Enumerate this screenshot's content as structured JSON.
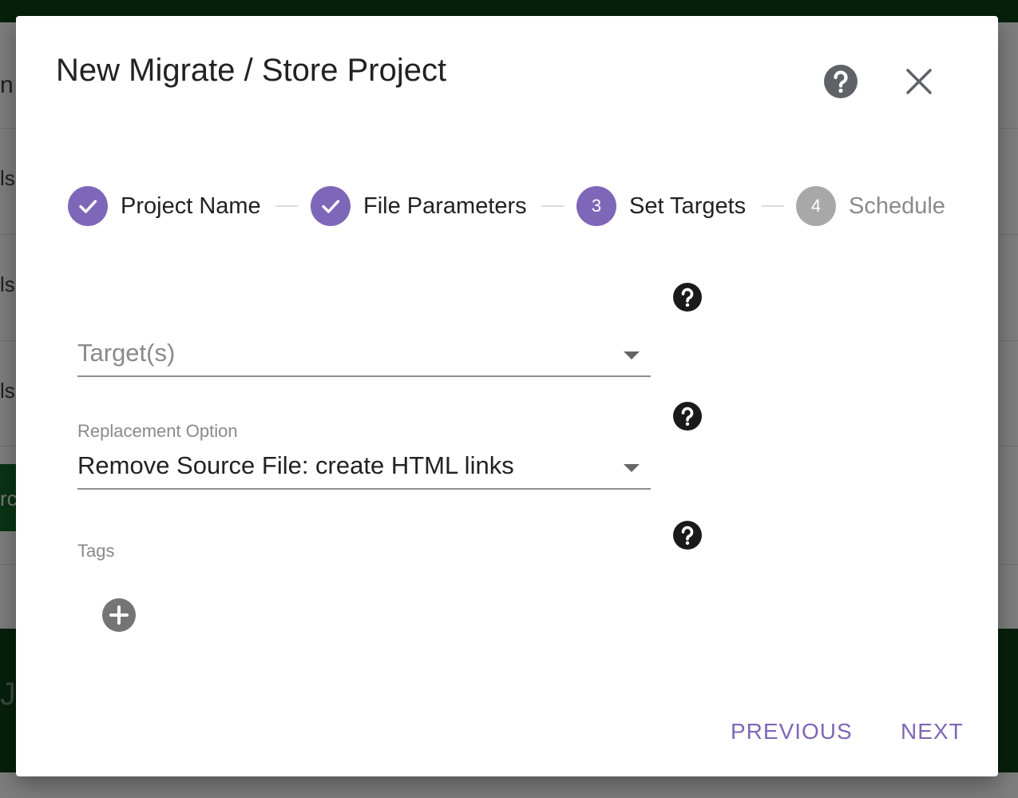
{
  "background": {
    "row_letters": [
      "n",
      "ls",
      "ls",
      "ls"
    ],
    "green_button_fragment": "rc",
    "band_fragment": "Jo"
  },
  "dialog": {
    "title": "New Migrate / Store Project",
    "help_icon": "help-circle-icon",
    "close_icon": "close-icon"
  },
  "stepper": {
    "steps": [
      {
        "number": "1",
        "label": "Project Name",
        "status": "completed",
        "icon": "check-icon"
      },
      {
        "number": "2",
        "label": "File Parameters",
        "status": "completed",
        "icon": "check-icon"
      },
      {
        "number": "3",
        "label": "Set Targets",
        "status": "active"
      },
      {
        "number": "4",
        "label": "Schedule",
        "status": "inactive"
      }
    ]
  },
  "form": {
    "targets": {
      "placeholder": "Target(s)",
      "value": ""
    },
    "replacement": {
      "label": "Replacement Option",
      "value": "Remove Source File: create HTML links"
    },
    "tags": {
      "label": "Tags",
      "add_icon": "add-circle-icon"
    }
  },
  "actions": {
    "previous_label": "PREVIOUS",
    "next_label": "NEXT"
  },
  "colors": {
    "accent": "#7e67b8",
    "inactive_step": "#a8a8a8",
    "background_green": "#06200c"
  }
}
